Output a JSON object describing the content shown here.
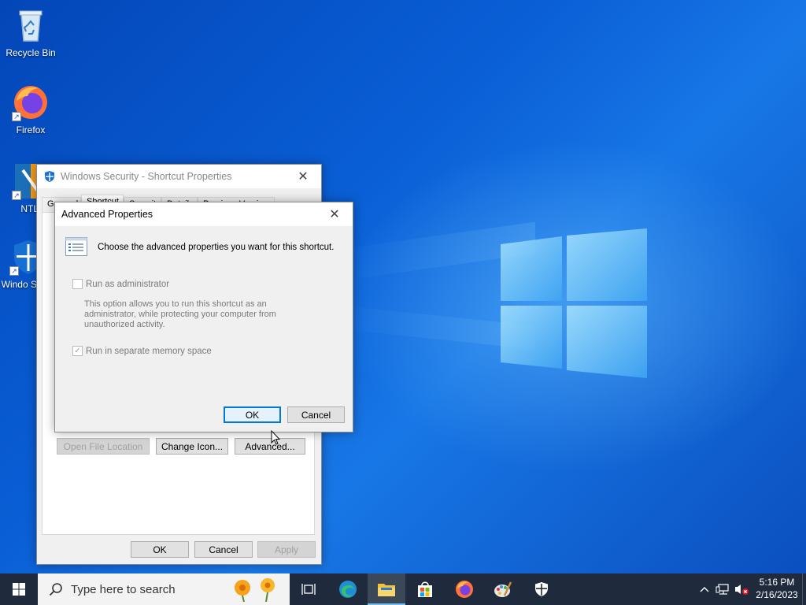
{
  "desktop": {
    "icons": [
      {
        "label": "Recycle Bin"
      },
      {
        "label": "Firefox"
      },
      {
        "label": "NTLi"
      },
      {
        "label": "Windo Secur"
      }
    ]
  },
  "properties_dialog": {
    "title": "Windows Security - Shortcut Properties",
    "tabs": [
      "General",
      "Shortcut",
      "Security",
      "Details",
      "Previous Versions"
    ],
    "selected_tab": "Shortcut",
    "buttons": {
      "open_file_location": "Open File Location",
      "change_icon": "Change Icon...",
      "advanced": "Advanced...",
      "ok": "OK",
      "cancel": "Cancel",
      "apply": "Apply"
    }
  },
  "advanced_dialog": {
    "title": "Advanced Properties",
    "header": "Choose the advanced properties you want for this shortcut.",
    "run_as_admin": {
      "label": "Run as administrator",
      "checked": false,
      "enabled": false
    },
    "description": "This option allows you to run this shortcut as an administrator, while protecting your computer from unauthorized activity.",
    "separate_memory": {
      "label": "Run in separate memory space",
      "checked": true,
      "enabled": false
    },
    "ok": "OK",
    "cancel": "Cancel"
  },
  "taskbar": {
    "search_placeholder": "Type here to search",
    "clock_time": "5:16 PM",
    "clock_date": "2/16/2023"
  },
  "colors": {
    "accent": "#0078d7",
    "taskbar": "#1f2b3c",
    "wallpaper": "#0a58c9"
  }
}
